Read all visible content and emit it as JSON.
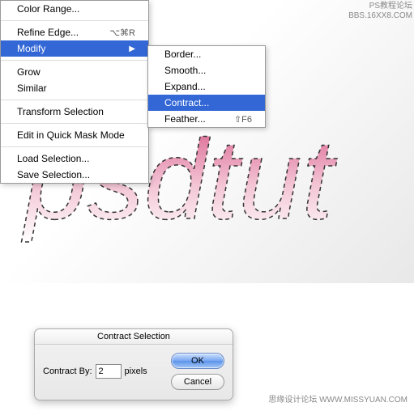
{
  "watermark": {
    "top1": "PS教程论坛",
    "top2": "BBS.16XX8.COM",
    "bottom": "思缘设计论坛  WWW.MISSYUAN.COM"
  },
  "menu": {
    "items": [
      {
        "label": "Color Range..."
      },
      {
        "sep": true
      },
      {
        "label": "Refine Edge...",
        "shortcut": "⌥⌘R"
      },
      {
        "label": "Modify",
        "submenu": true,
        "highlighted": true
      },
      {
        "sep": true
      },
      {
        "label": "Grow"
      },
      {
        "label": "Similar"
      },
      {
        "sep": true
      },
      {
        "label": "Transform Selection"
      },
      {
        "sep": true
      },
      {
        "label": "Edit in Quick Mask Mode"
      },
      {
        "sep": true
      },
      {
        "label": "Load Selection..."
      },
      {
        "label": "Save Selection..."
      }
    ]
  },
  "submenu": {
    "items": [
      {
        "label": "Border..."
      },
      {
        "label": "Smooth..."
      },
      {
        "label": "Expand..."
      },
      {
        "label": "Contract...",
        "highlighted": true
      },
      {
        "label": "Feather...",
        "shortcut": "⇧F6"
      }
    ]
  },
  "dialog": {
    "title": "Contract Selection",
    "field_label": "Contract By:",
    "value": "2",
    "unit": "pixels",
    "ok": "OK",
    "cancel": "Cancel"
  },
  "art_text": "psdtut"
}
